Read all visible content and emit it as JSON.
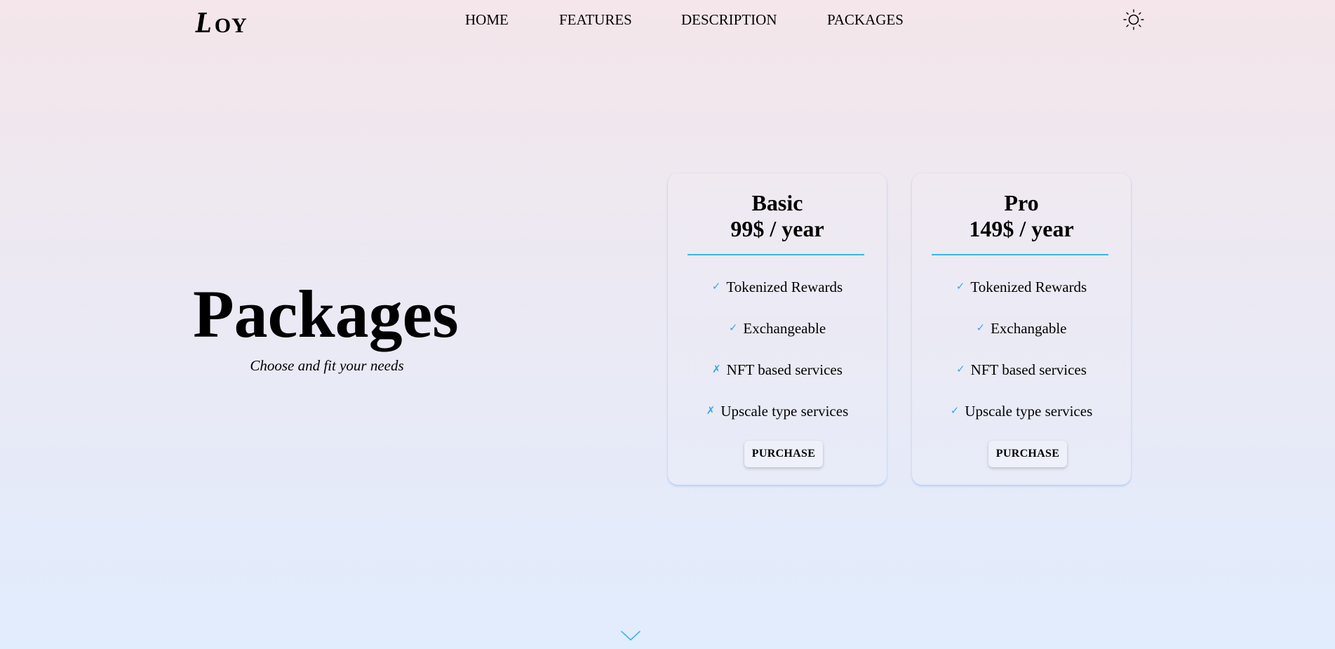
{
  "header": {
    "logo_initial": "L",
    "logo_rest": "OY",
    "nav": [
      {
        "label": "HOME"
      },
      {
        "label": "FEATURES"
      },
      {
        "label": "DESCRIPTION"
      },
      {
        "label": "PACKAGES"
      }
    ],
    "theme_icon": "sun-icon"
  },
  "hero": {
    "title": "Packages",
    "subtitle": "Choose and fit your needs"
  },
  "colors": {
    "accent": "#38b6f0",
    "mark": "#3aa6e8",
    "background_top": "#f4e6ea",
    "background_bottom": "#e1ecfd"
  },
  "packages": [
    {
      "name": "Basic",
      "price": "99$ / year",
      "features": [
        {
          "mark": "✓",
          "text": "Tokenized Rewards"
        },
        {
          "mark": "✓",
          "text": "Exchangeable"
        },
        {
          "mark": "✗",
          "text": "NFT based services"
        },
        {
          "mark": "✗",
          "text": "Upscale type services"
        }
      ],
      "button": "PURCHASE"
    },
    {
      "name": "Pro",
      "price": "149$ / year",
      "features": [
        {
          "mark": "✓",
          "text": "Tokenized Rewards"
        },
        {
          "mark": "✓",
          "text": "Exchangable"
        },
        {
          "mark": "✓",
          "text": "NFT based services"
        },
        {
          "mark": "✓",
          "text": "Upscale type services"
        }
      ],
      "button": "PURCHASE"
    }
  ],
  "scroll_icon": "chevron-down-icon"
}
